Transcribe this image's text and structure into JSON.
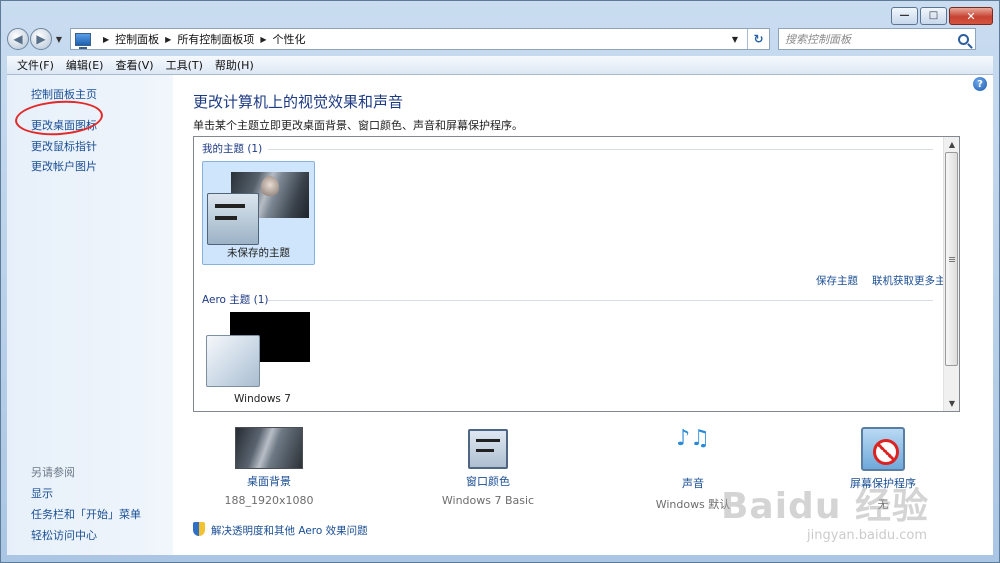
{
  "window": {
    "minimize_glyph": "—",
    "maximize_glyph": "□",
    "close_glyph": "✕"
  },
  "address_bar": {
    "crumbs": [
      "控制面板",
      "所有控制面板项",
      "个性化"
    ],
    "search_placeholder": "搜索控制面板"
  },
  "menu": [
    "文件(F)",
    "编辑(E)",
    "查看(V)",
    "工具(T)",
    "帮助(H)"
  ],
  "sidebar": {
    "links": [
      "控制面板主页",
      "更改桌面图标",
      "更改鼠标指针",
      "更改帐户图片"
    ],
    "see_also_heading": "另请参阅",
    "see_also_links": [
      "显示",
      "任务栏和「开始」菜单",
      "轻松访问中心"
    ]
  },
  "main": {
    "title": "更改计算机上的视觉效果和声音",
    "description": "单击某个主题立即更改桌面背景、窗口颜色、声音和屏幕保护程序。",
    "my_themes_heading": "我的主题 (1)",
    "unsaved_theme_label": "未保存的主题",
    "save_theme_link": "保存主题",
    "get_more_link": "联机获取更多主题",
    "aero_heading": "Aero 主题 (1)",
    "aero_theme_label": "Windows 7",
    "troubleshoot_link": "解决透明度和其他 Aero 效果问题"
  },
  "options": [
    {
      "title": "桌面背景",
      "subtitle": "188_1920x1080",
      "icon": "desktop-background-icon"
    },
    {
      "title": "窗口颜色",
      "subtitle": "Windows 7 Basic",
      "icon": "window-color-icon"
    },
    {
      "title": "声音",
      "subtitle": "Windows 默认",
      "icon": "sound-icon"
    },
    {
      "title": "屏幕保护程序",
      "subtitle": "无",
      "icon": "screen-saver-icon"
    }
  ],
  "watermark": {
    "text": "Baidu 经验",
    "sub": "jingyan.baidu.com"
  },
  "colors": {
    "link": "#1b4f95",
    "title": "#1d3b83",
    "annotation": "#e12a2a",
    "selected_tile": "#cfe5fb"
  }
}
